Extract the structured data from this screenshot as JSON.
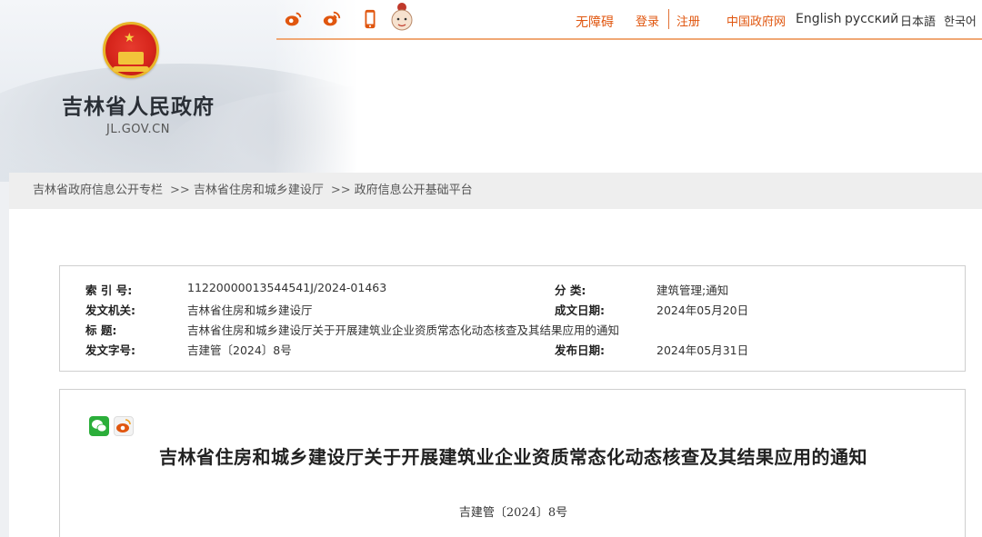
{
  "header": {
    "site_title": "吉林省人民政府",
    "site_domain": "JL.GOV.CN"
  },
  "topbar": {
    "icons": [
      "weibo-icon",
      "weibo-icon",
      "mobile-icon",
      "avatar-icon"
    ],
    "barrier_free": "无障碍",
    "login": "登录",
    "register": "注册",
    "china_gov": "中国政府网",
    "english": "English",
    "russian": "русский",
    "japanese": "日本語",
    "korean": "한국어"
  },
  "breadcrumb": {
    "items": [
      "吉林省政府信息公开专栏",
      "吉林省住房和城乡建设厅",
      "政府信息公开基础平台"
    ],
    "separator": ">>"
  },
  "meta": {
    "index_label": "索  引  号:",
    "index_value": "11220000013544541J/2024-01463",
    "category_label": "分    类:",
    "category_value": "建筑管理;通知",
    "issuer_label": "发文机关:",
    "issuer_value": "吉林省住房和城乡建设厅",
    "created_label": "成文日期:",
    "created_value": "2024年05月20日",
    "title_label": "标      题:",
    "title_value": "吉林省住房和城乡建设厅关于开展建筑业企业资质常态化动态核查及其结果应用的通知",
    "docno_label": "发文字号:",
    "docno_value": "吉建管〔2024〕8号",
    "published_label": "发布日期:",
    "published_value": "2024年05月31日"
  },
  "document": {
    "title": "吉林省住房和城乡建设厅关于开展建筑业企业资质常态化动态核查及其结果应用的通知",
    "number": "吉建管〔2024〕8号"
  },
  "colors": {
    "accent": "#e0560f",
    "emblem_red": "#d7261c",
    "emblem_gold": "#e8b62a",
    "wechat_green": "#2bae3a"
  }
}
